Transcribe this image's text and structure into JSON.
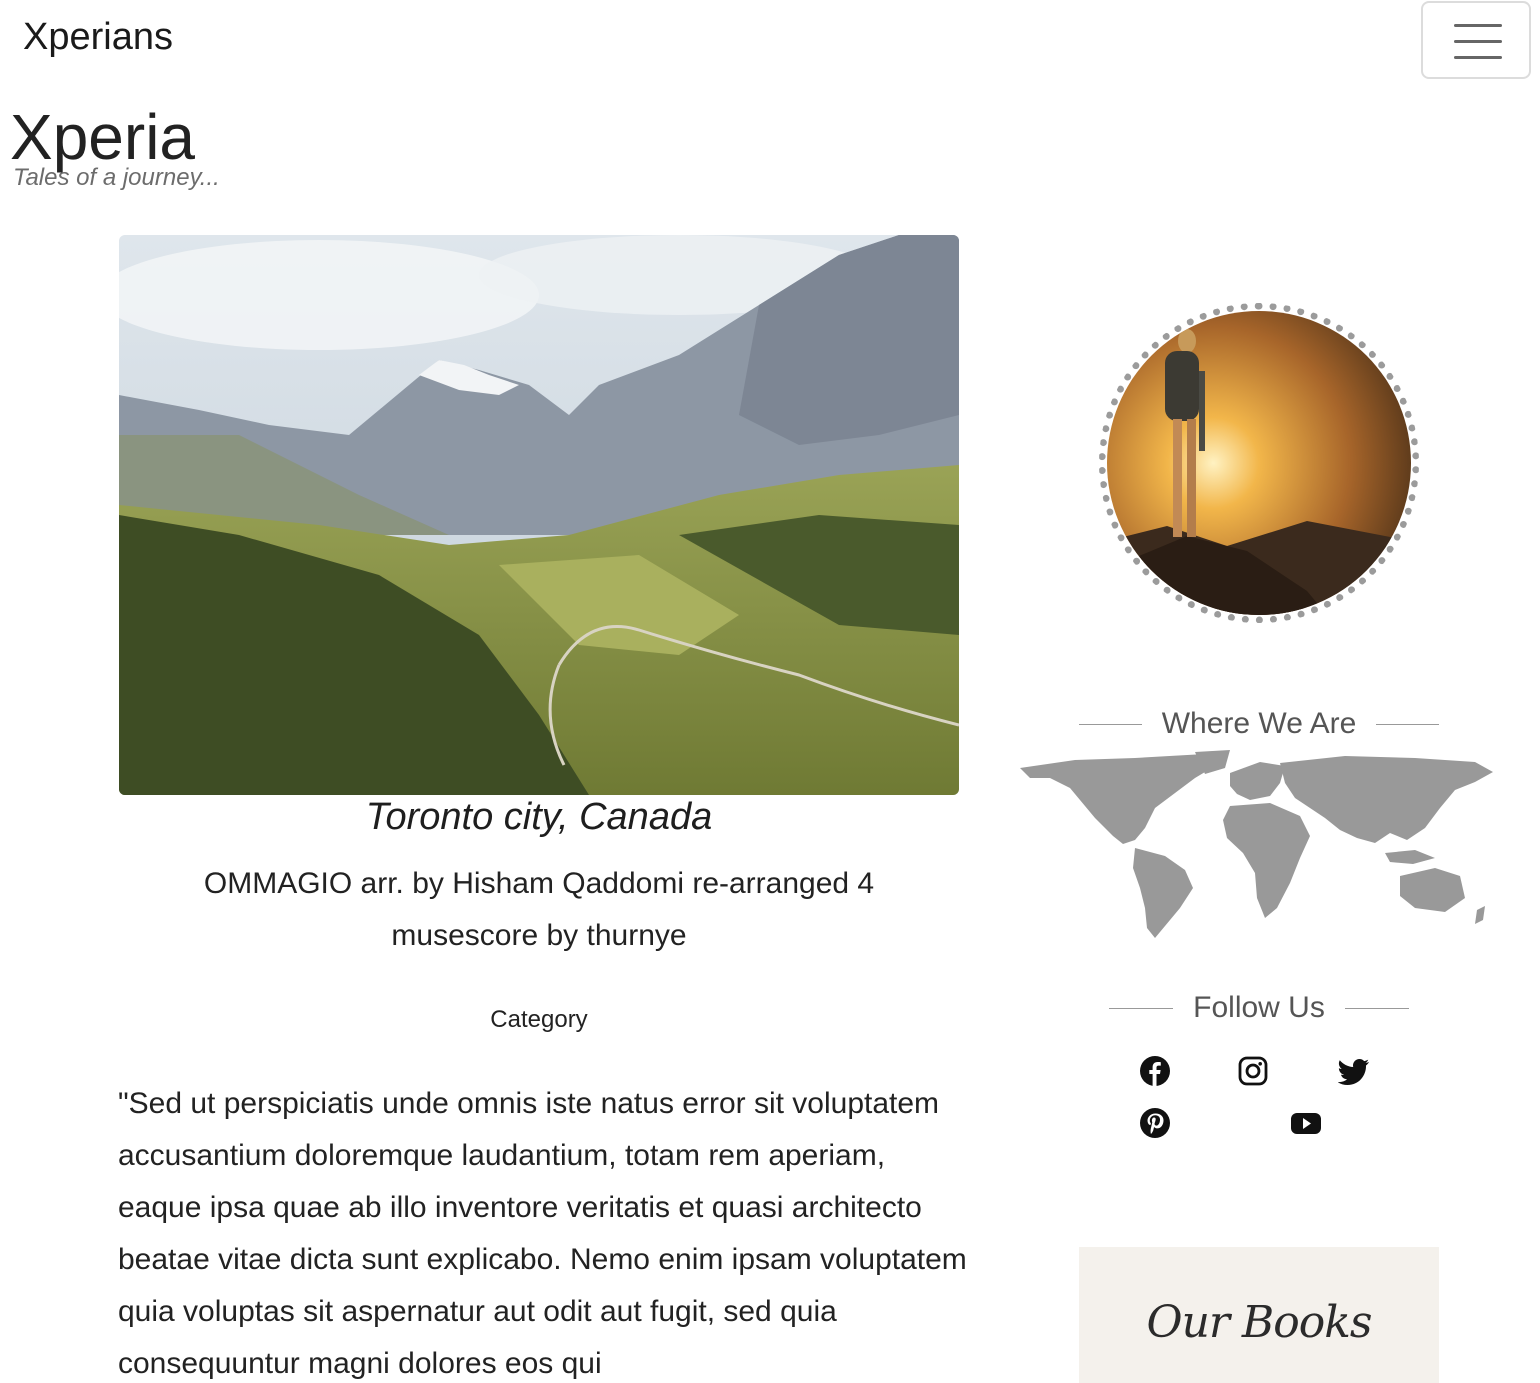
{
  "navbar": {
    "brand": "Xperians",
    "toggle_icon": "hamburger-menu-icon"
  },
  "header": {
    "title": "Xperia",
    "tagline": "Tales of a journey..."
  },
  "post": {
    "image": "mountain-valley-landscape-photo",
    "title": "Toronto city, Canada",
    "subtitle": "OMMAGIO arr. by Hisham Qaddomi re-arranged 4 musescore by thurnye",
    "category": "Category",
    "body": "\"Sed ut perspiciatis unde omnis iste natus error sit voluptatem accusantium doloremque laudantium, totam rem aperiam, eaque ipsa quae ab illo inventore veritatis et quasi architecto beatae vitae dicta sunt explicabo. Nemo enim ipsam voluptatem quia voluptas sit aspernatur aut odit aut fugit, sed quia consequuntur magni dolores eos qui"
  },
  "sidebar": {
    "avatar": "hiker-at-sunset-photo",
    "where_heading": "Where We Are",
    "map": "world-map-image",
    "follow_heading": "Follow Us",
    "social": [
      {
        "name": "facebook",
        "icon": "facebook-icon"
      },
      {
        "name": "instagram",
        "icon": "instagram-icon"
      },
      {
        "name": "twitter",
        "icon": "twitter-icon"
      },
      {
        "name": "pinterest",
        "icon": "pinterest-icon"
      },
      {
        "name": "youtube",
        "icon": "youtube-icon"
      }
    ],
    "books_label": "Our Books"
  },
  "colors": {
    "text": "#222222",
    "muted": "#6c6c6c",
    "map_gray": "#999999",
    "books_bg": "#f4f1ec"
  }
}
